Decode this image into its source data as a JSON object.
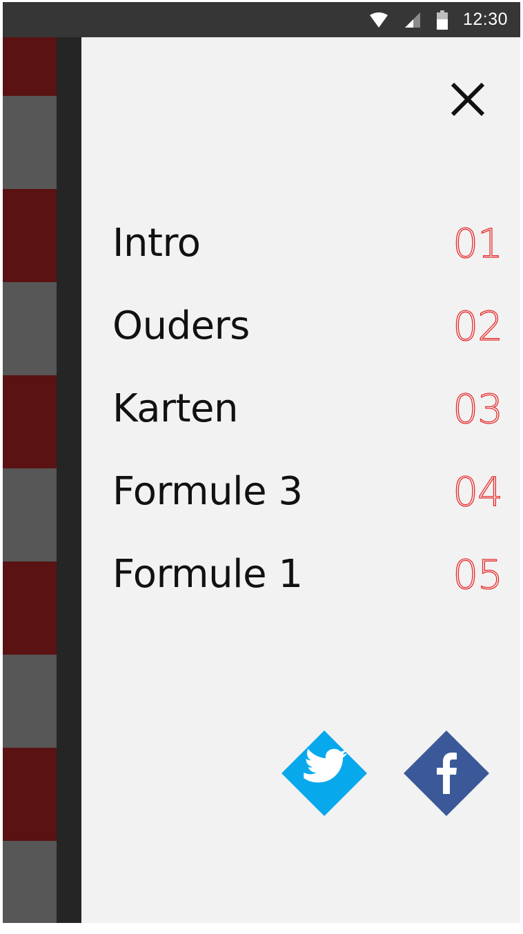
{
  "status_bar": {
    "time": "12:30",
    "icons": [
      "wifi-icon",
      "cell-signal-icon",
      "battery-icon"
    ]
  },
  "menu": {
    "items": [
      {
        "label": "Intro",
        "number": "01"
      },
      {
        "label": "Ouders",
        "number": "02"
      },
      {
        "label": "Karten",
        "number": "03"
      },
      {
        "label": "Formule 3",
        "number": "04"
      },
      {
        "label": "Formule 1",
        "number": "05"
      }
    ]
  },
  "social": {
    "twitter_icon": "twitter-icon",
    "facebook_icon": "facebook-icon"
  },
  "colors": {
    "accent": "#e62a2a",
    "drawer_background": "#f2f2f2",
    "stripe_red": "#5a1212",
    "stripe_grey": "#575757",
    "twitter": "#08a8ec",
    "facebook": "#3b5998"
  }
}
